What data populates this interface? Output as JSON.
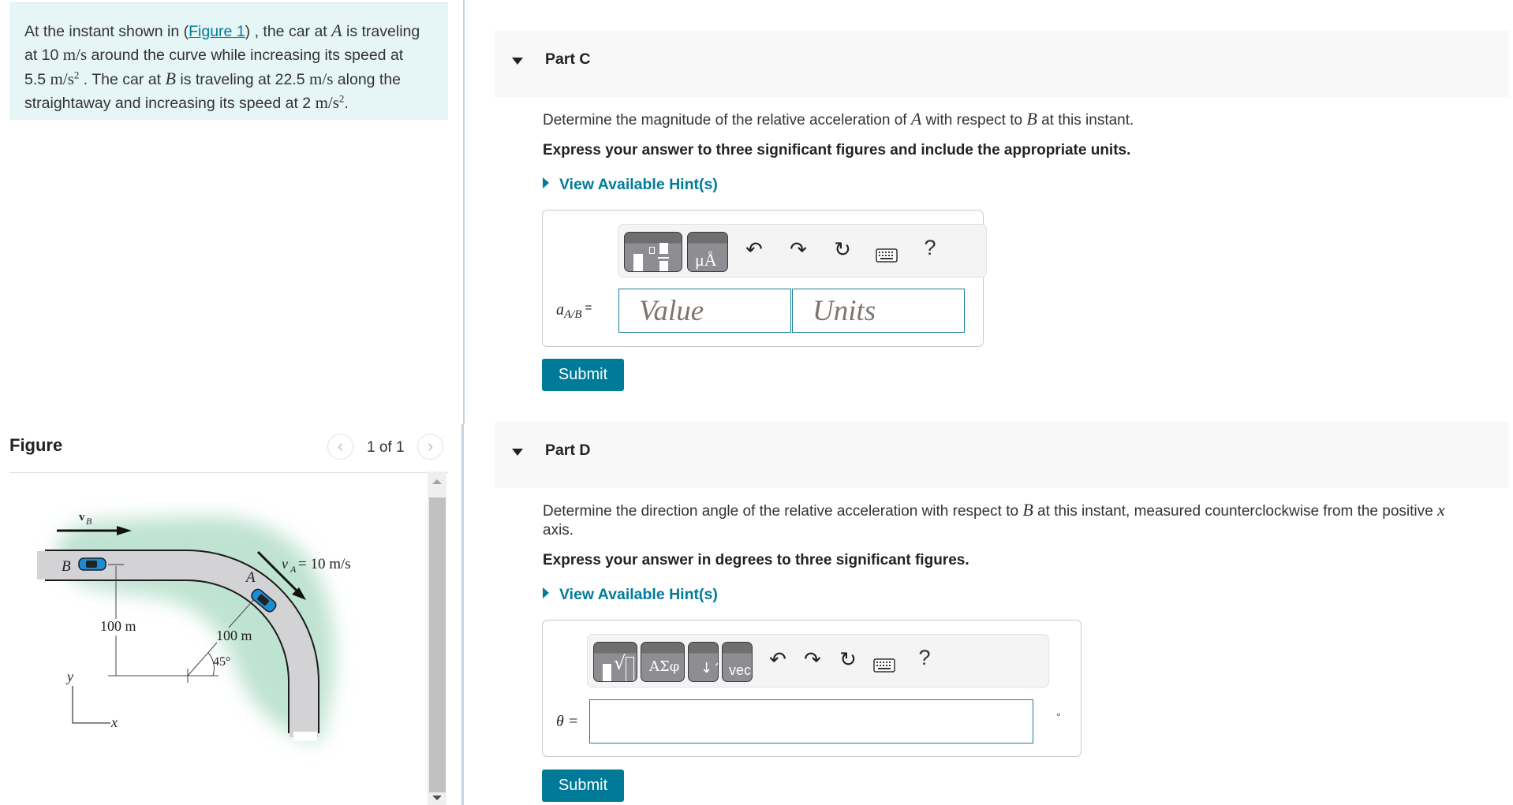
{
  "problem": {
    "text_1": "At the instant shown in (",
    "figure_link": "Figure 1",
    "text_2": ") , the car at ",
    "A": "A",
    "text_3": " is traveling",
    "text_4": "at 10 ",
    "unit_ms": "m/s",
    "text_5": " around the curve while increasing its speed at",
    "text_6": "5.5 ",
    "unit_ms2": "m/s",
    "sq": "2",
    "text_7": " . The car at ",
    "B": "B",
    "text_8": " is traveling at 22.5 ",
    "text_9": " along the",
    "text_10": "straightaway and increasing its speed at 2 ",
    "text_11": "."
  },
  "figure": {
    "title": "Figure",
    "counter": "1 of 1",
    "prev_icon": "‹",
    "next_icon": "›",
    "labels": {
      "vB": "v",
      "vB_sub": "B",
      "B": "B",
      "A": "A",
      "vA": "v",
      "vA_sub": "A",
      "vA_value": " = 10 m/s",
      "dist1": "100 m",
      "dist2": "100 m",
      "angle": "45°",
      "axis_y": "y",
      "axis_x": "x"
    }
  },
  "parts": [
    {
      "title": "Part C",
      "prompt_1": "Determine the magnitude of the relative acceleration of ",
      "prompt_A": "A",
      "prompt_2": " with respect to ",
      "prompt_B": "B",
      "prompt_3": " at this instant.",
      "instruction": "Express your answer to three significant figures and include the appropriate units.",
      "hint": "View Available Hint(s)",
      "answer_label_var": "a",
      "answer_label_sub": "A/B",
      "answer_label_eq": " =",
      "value_placeholder": "Value",
      "units_placeholder": "Units",
      "submit": "Submit",
      "toolbar": [
        "templates-icon",
        "units-icon",
        "undo-icon",
        "redo-icon",
        "reset-icon",
        "keyboard-icon",
        "help-icon"
      ]
    },
    {
      "title": "Part D",
      "prompt_1": "Determine the direction angle of the relative acceleration with respect to ",
      "prompt_B": "B",
      "prompt_2": " at this instant, measured counterclockwise from the positive ",
      "prompt_x": "x",
      "prompt_3": "axis.",
      "instruction": "Express your answer in degrees to three significant figures.",
      "hint": "View Available Hint(s)",
      "answer_label": "θ =",
      "answer_value": "",
      "unit_symbol": "°",
      "submit": "Submit",
      "toolbar_greek": "ΑΣφ",
      "toolbar_vec": "vec",
      "toolbar": [
        "templates-icon",
        "greek-icon",
        "arrows-icon",
        "vec-icon",
        "undo-icon",
        "redo-icon",
        "reset-icon",
        "keyboard-icon",
        "help-icon"
      ]
    }
  ],
  "icons": {
    "undo": "↶",
    "redo": "↷",
    "reset": "↻",
    "help": "?"
  },
  "colors": {
    "accent": "#007a99",
    "link": "#007c9b",
    "problem_bg": "#e6f5f6",
    "part_header_bg": "#f8f8f8",
    "grass": "#bfe3d3",
    "road": "#d3d3d5",
    "car": "#1e8ccf"
  }
}
